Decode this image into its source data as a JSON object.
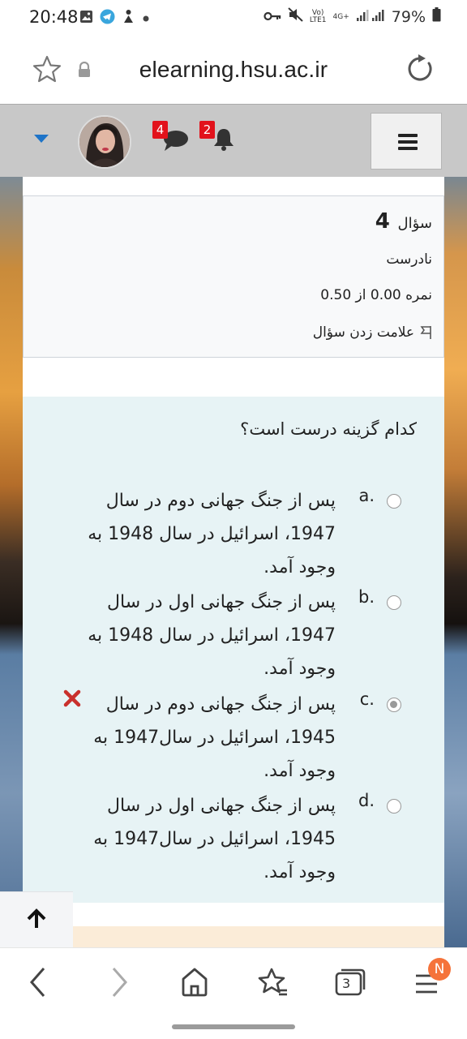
{
  "status_bar": {
    "time": "20:48",
    "battery": "79%",
    "network_small_1": "Vo)",
    "network_small_2": "LTE1",
    "network_gen": "4G+"
  },
  "browser": {
    "url": "elearning.hsu.ac.ir",
    "tab_count": "3",
    "menu_badge": "N"
  },
  "navbar": {
    "messages_count": "4",
    "notifications_count": "2"
  },
  "question_info": {
    "label": "سؤال",
    "number": "4",
    "state": "نادرست",
    "grade": "نمره 0.00 از 0.50",
    "flag": "علامت زدن سؤال"
  },
  "question": {
    "text": "کدام گزینه درست است؟",
    "answers": [
      {
        "letter": "a.",
        "text": "پس از جنگ جهانی دوم در سال 1947، اسرائیل در سال 1948 به وجود آمد.",
        "checked": false,
        "wrong": false
      },
      {
        "letter": "b.",
        "text": "پس از جنگ جهانی اول در سال 1947، اسرائیل در سال 1948 به وجود آمد.",
        "checked": false,
        "wrong": false
      },
      {
        "letter": "c.",
        "text": "پس از جنگ جهانی دوم در سال 1945، اسرائیل در سال1947 به وجود آمد.",
        "checked": true,
        "wrong": true
      },
      {
        "letter": "d.",
        "text": "پس از جنگ جهانی اول در سال 1945، اسرائیل در سال1947 به وجود آمد.",
        "checked": false,
        "wrong": false
      }
    ]
  },
  "colors": {
    "badge_red": "#e2121b",
    "wrong_red": "#c9302c",
    "accent_blue": "#1e74c8",
    "content_bg": "#e7f3f5"
  }
}
